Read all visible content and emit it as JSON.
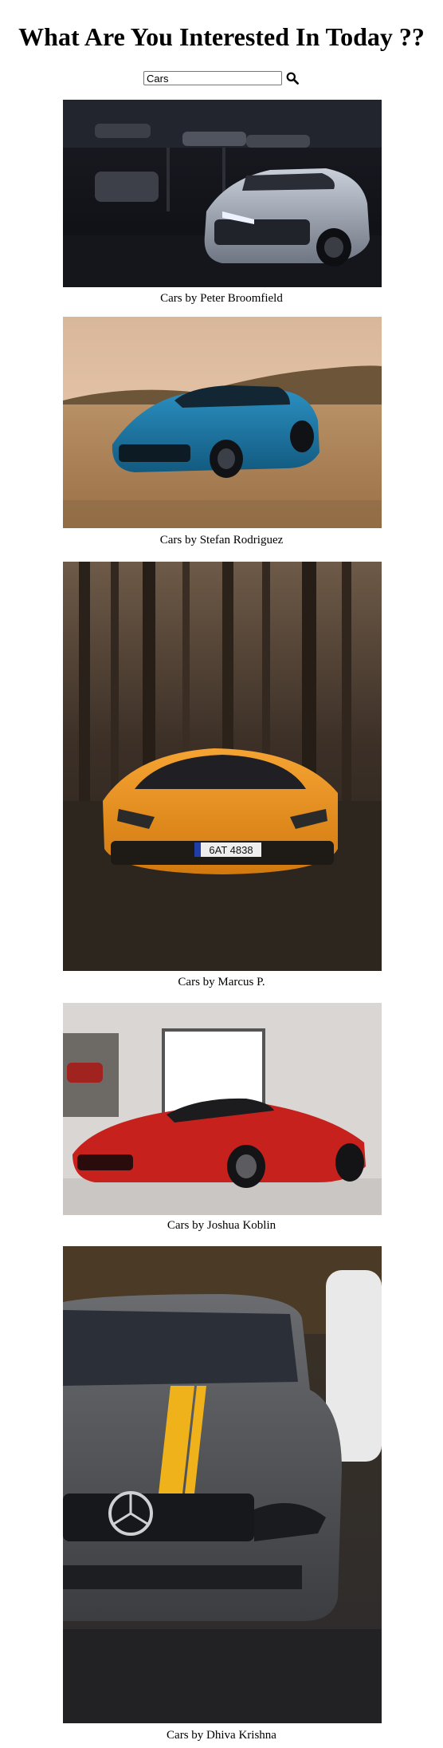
{
  "page": {
    "title": "What Are You Interested In Today ??"
  },
  "search": {
    "value": "Cars",
    "button_icon": "search-icon"
  },
  "results": [
    {
      "caption": "Cars by Peter Broomfield"
    },
    {
      "caption": "Cars by Stefan Rodriguez"
    },
    {
      "caption": "Cars by Marcus P."
    },
    {
      "caption": "Cars by Joshua Koblin"
    },
    {
      "caption": "Cars by Dhiva Krishna"
    }
  ],
  "photo_plates": {
    "lamborghini": "6AT 4838"
  }
}
